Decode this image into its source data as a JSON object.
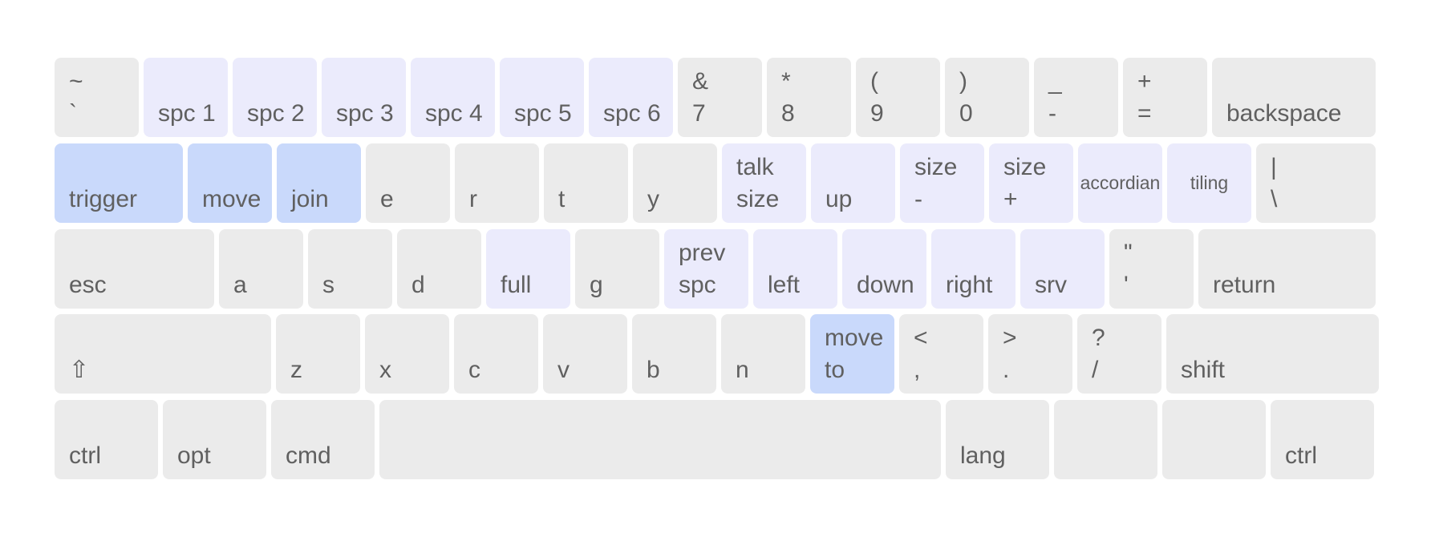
{
  "colors": {
    "key_default": "#ebebeb",
    "key_highlight_light": "#ebebfc",
    "key_highlight_strong": "#c9d9fb",
    "label_text": "#606060"
  },
  "keyboard": {
    "rows": [
      {
        "keys": [
          {
            "id": "backtick",
            "top": "~",
            "bottom": "`",
            "highlight": "none"
          },
          {
            "id": "1",
            "top": "",
            "bottom": "spc 1",
            "highlight": "light"
          },
          {
            "id": "2",
            "top": "",
            "bottom": "spc 2",
            "highlight": "light"
          },
          {
            "id": "3",
            "top": "",
            "bottom": "spc 3",
            "highlight": "light"
          },
          {
            "id": "4",
            "top": "",
            "bottom": "spc 4",
            "highlight": "light"
          },
          {
            "id": "5",
            "top": "",
            "bottom": "spc 5",
            "highlight": "light"
          },
          {
            "id": "6",
            "top": "",
            "bottom": "spc 6",
            "highlight": "light"
          },
          {
            "id": "7",
            "top": "&",
            "bottom": "7",
            "highlight": "none"
          },
          {
            "id": "8",
            "top": "*",
            "bottom": "8",
            "highlight": "none"
          },
          {
            "id": "9",
            "top": "(",
            "bottom": "9",
            "highlight": "none"
          },
          {
            "id": "0",
            "top": ")",
            "bottom": "0",
            "highlight": "none"
          },
          {
            "id": "minus",
            "top": "_",
            "bottom": "-",
            "highlight": "none"
          },
          {
            "id": "equals",
            "top": "+",
            "bottom": "=",
            "highlight": "none"
          },
          {
            "id": "backspace",
            "top": "",
            "bottom": "backspace",
            "highlight": "none"
          }
        ]
      },
      {
        "keys": [
          {
            "id": "tab",
            "top": "",
            "bottom": "trigger",
            "highlight": "strong"
          },
          {
            "id": "q",
            "top": "",
            "bottom": "move",
            "highlight": "strong"
          },
          {
            "id": "w",
            "top": "",
            "bottom": "join",
            "highlight": "strong"
          },
          {
            "id": "e",
            "top": "",
            "bottom": "e",
            "highlight": "none"
          },
          {
            "id": "r",
            "top": "",
            "bottom": "r",
            "highlight": "none"
          },
          {
            "id": "t",
            "top": "",
            "bottom": "t",
            "highlight": "none"
          },
          {
            "id": "y",
            "top": "",
            "bottom": "y",
            "highlight": "none"
          },
          {
            "id": "u",
            "top": "talk",
            "bottom": "size",
            "highlight": "light"
          },
          {
            "id": "i",
            "top": "",
            "bottom": "up",
            "highlight": "light"
          },
          {
            "id": "o",
            "top": "size",
            "bottom": "-",
            "highlight": "light"
          },
          {
            "id": "p",
            "top": "size",
            "bottom": "+",
            "highlight": "light"
          },
          {
            "id": "lbracket",
            "center": "accordian",
            "highlight": "light"
          },
          {
            "id": "rbracket",
            "center": "tiling",
            "highlight": "light"
          },
          {
            "id": "backslash",
            "top": "|",
            "bottom": "\\",
            "highlight": "none"
          }
        ]
      },
      {
        "keys": [
          {
            "id": "caps",
            "top": "",
            "bottom": "esc",
            "highlight": "none"
          },
          {
            "id": "a",
            "top": "",
            "bottom": "a",
            "highlight": "none"
          },
          {
            "id": "s",
            "top": "",
            "bottom": "s",
            "highlight": "none"
          },
          {
            "id": "d",
            "top": "",
            "bottom": "d",
            "highlight": "none"
          },
          {
            "id": "f",
            "top": "",
            "bottom": "full",
            "highlight": "light"
          },
          {
            "id": "g",
            "top": "",
            "bottom": "g",
            "highlight": "none"
          },
          {
            "id": "h",
            "top": "prev",
            "bottom": "spc",
            "highlight": "light"
          },
          {
            "id": "j",
            "top": "",
            "bottom": "left",
            "highlight": "light"
          },
          {
            "id": "k",
            "top": "",
            "bottom": "down",
            "highlight": "light"
          },
          {
            "id": "l",
            "top": "",
            "bottom": "right",
            "highlight": "light"
          },
          {
            "id": "semicolon",
            "top": "",
            "bottom": "srv",
            "highlight": "light"
          },
          {
            "id": "quote",
            "top": "\"",
            "bottom": "'",
            "highlight": "none"
          },
          {
            "id": "return",
            "top": "",
            "bottom": "return",
            "highlight": "none"
          }
        ]
      },
      {
        "keys": [
          {
            "id": "lshift",
            "top": "",
            "bottom": "⇧",
            "highlight": "none"
          },
          {
            "id": "z",
            "top": "",
            "bottom": "z",
            "highlight": "none"
          },
          {
            "id": "x",
            "top": "",
            "bottom": "x",
            "highlight": "none"
          },
          {
            "id": "c",
            "top": "",
            "bottom": "c",
            "highlight": "none"
          },
          {
            "id": "v",
            "top": "",
            "bottom": "v",
            "highlight": "none"
          },
          {
            "id": "b",
            "top": "",
            "bottom": "b",
            "highlight": "none"
          },
          {
            "id": "n",
            "top": "",
            "bottom": "n",
            "highlight": "none"
          },
          {
            "id": "m",
            "top": "move",
            "bottom": "to",
            "highlight": "strong"
          },
          {
            "id": "comma",
            "top": "<",
            "bottom": ",",
            "highlight": "none"
          },
          {
            "id": "period",
            "top": ">",
            "bottom": ".",
            "highlight": "none"
          },
          {
            "id": "slash",
            "top": "?",
            "bottom": "/",
            "highlight": "none"
          },
          {
            "id": "rshift",
            "top": "",
            "bottom": "shift",
            "highlight": "none"
          }
        ]
      },
      {
        "keys": [
          {
            "id": "lctrl",
            "top": "",
            "bottom": "ctrl",
            "highlight": "none"
          },
          {
            "id": "lopt",
            "top": "",
            "bottom": "opt",
            "highlight": "none"
          },
          {
            "id": "lcmd",
            "top": "",
            "bottom": "cmd",
            "highlight": "none"
          },
          {
            "id": "space",
            "top": "",
            "bottom": "",
            "highlight": "none"
          },
          {
            "id": "lang",
            "top": "",
            "bottom": "lang",
            "highlight": "none"
          },
          {
            "id": "blank1",
            "top": "",
            "bottom": "",
            "highlight": "none"
          },
          {
            "id": "blank2",
            "top": "",
            "bottom": "",
            "highlight": "none"
          },
          {
            "id": "rctrl",
            "top": "",
            "bottom": "ctrl",
            "highlight": "none"
          }
        ]
      }
    ]
  }
}
